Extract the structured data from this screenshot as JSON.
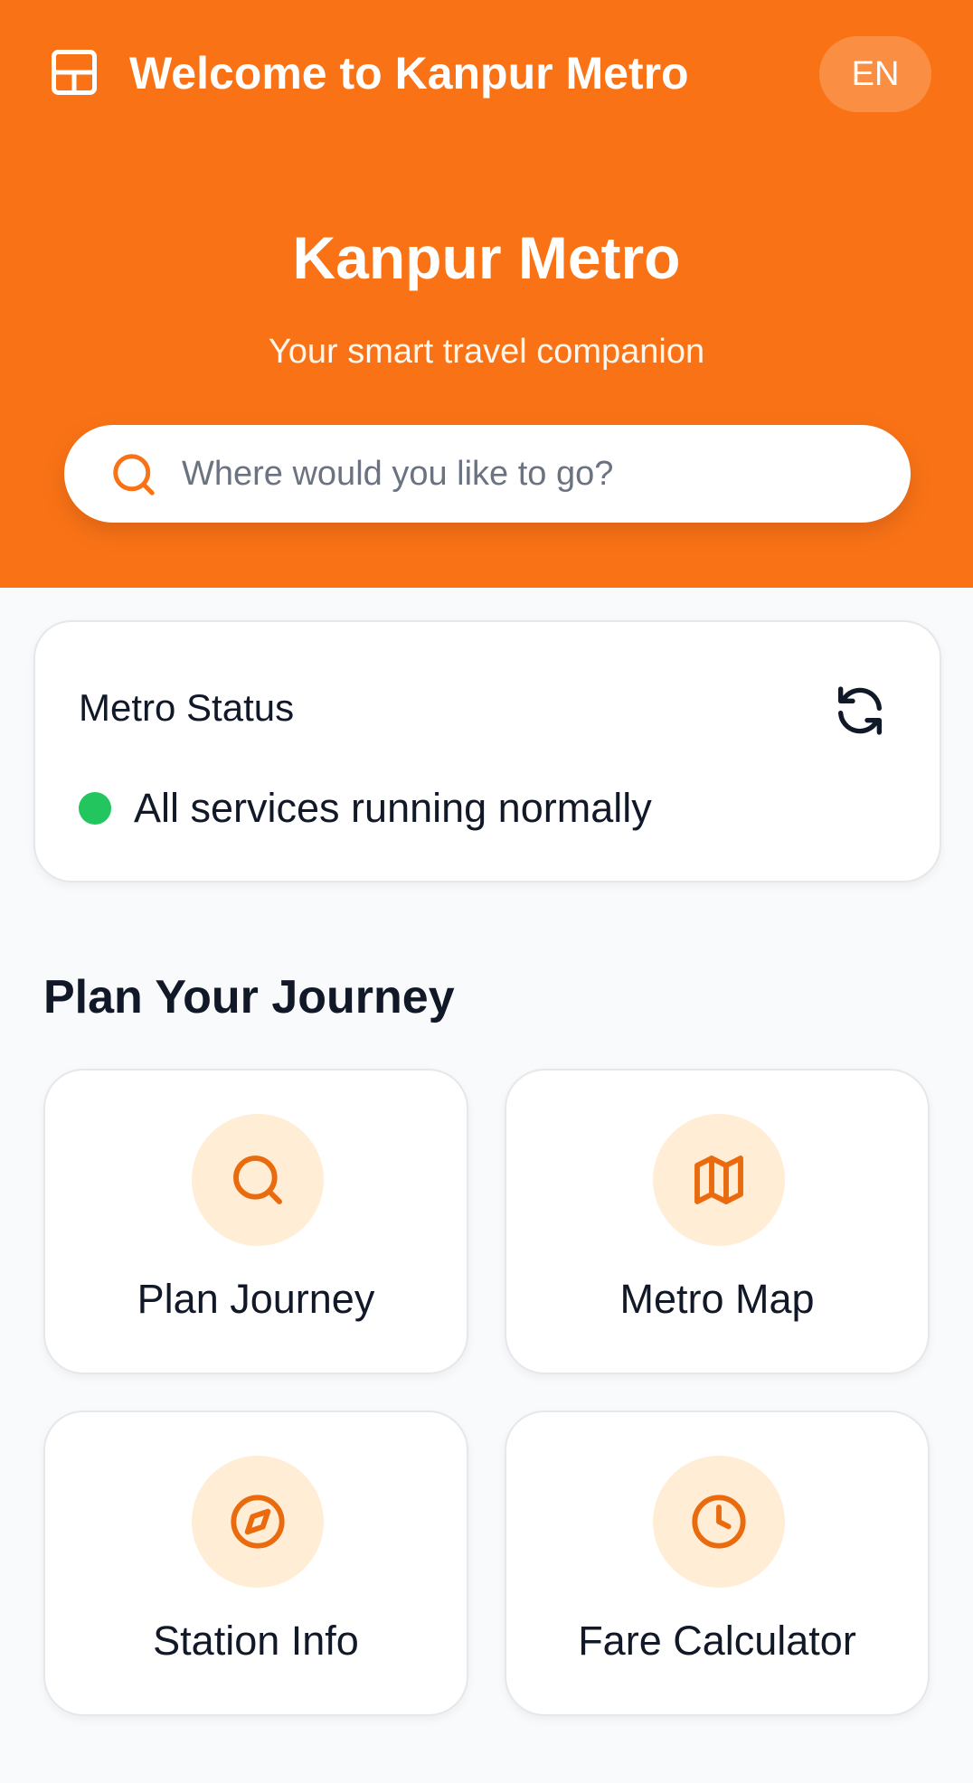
{
  "header": {
    "app_title": "Welcome to Kanpur Metro",
    "language": "EN",
    "icon": "layout-grid-icon"
  },
  "hero": {
    "title": "Kanpur Metro",
    "subtitle": "Your smart travel companion"
  },
  "search": {
    "placeholder": "Where would you like to go?",
    "value": ""
  },
  "status": {
    "title": "Metro Status",
    "message": "All services running normally",
    "state_color": "#22c55e",
    "refresh_icon": "refresh-icon"
  },
  "journey": {
    "section_title": "Plan Your Journey",
    "tiles": [
      {
        "label": "Plan Journey",
        "icon": "search-icon"
      },
      {
        "label": "Metro Map",
        "icon": "map-icon"
      },
      {
        "label": "Station Info",
        "icon": "compass-icon"
      },
      {
        "label": "Fare Calculator",
        "icon": "clock-icon"
      }
    ]
  },
  "colors": {
    "brand": "#f97316",
    "icon_bg": "#ffedd5",
    "background": "#f8fafc"
  }
}
